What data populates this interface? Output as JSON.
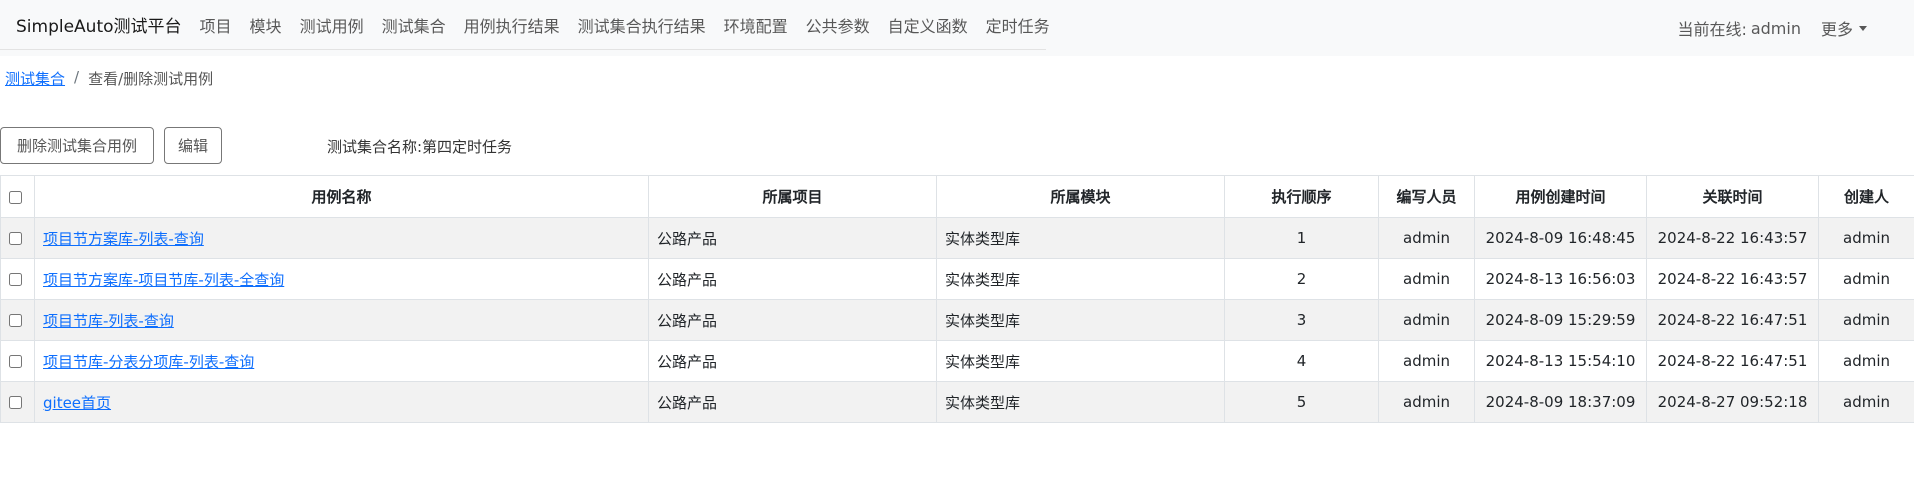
{
  "navbar": {
    "brand": "SimpleAuto测试平台",
    "links": [
      "项目",
      "模块",
      "测试用例",
      "测试集合",
      "用例执行结果",
      "测试集合执行结果",
      "环境配置",
      "公共参数",
      "自定义函数",
      "定时任务"
    ],
    "online_label": "当前在线:",
    "online_user": "admin",
    "more": "更多"
  },
  "breadcrumb": {
    "parent": "测试集合",
    "separator": "/",
    "current": "查看/删除测试用例"
  },
  "toolbar": {
    "delete_label": "删除测试集合用例",
    "edit_label": "编辑",
    "suite_name": "测试集合名称:第四定时任务"
  },
  "table": {
    "headers": [
      "用例名称",
      "所属项目",
      "所属模块",
      "执行顺序",
      "编写人员",
      "用例创建时间",
      "关联时间",
      "创建人"
    ],
    "rows": [
      {
        "name": "项目节方案库-列表-查询",
        "project": "公路产品",
        "module": "实体类型库",
        "order": "1",
        "writer": "admin",
        "created": "2024-8-09 16:48:45",
        "linked": "2024-8-22 16:43:57",
        "creator": "admin"
      },
      {
        "name": "项目节方案库-项目节库-列表-全查询",
        "project": "公路产品",
        "module": "实体类型库",
        "order": "2",
        "writer": "admin",
        "created": "2024-8-13 16:56:03",
        "linked": "2024-8-22 16:43:57",
        "creator": "admin"
      },
      {
        "name": "项目节库-列表-查询",
        "project": "公路产品",
        "module": "实体类型库",
        "order": "3",
        "writer": "admin",
        "created": "2024-8-09 15:29:59",
        "linked": "2024-8-22 16:47:51",
        "creator": "admin"
      },
      {
        "name": "项目节库-分表分项库-列表-查询",
        "project": "公路产品",
        "module": "实体类型库",
        "order": "4",
        "writer": "admin",
        "created": "2024-8-13 15:54:10",
        "linked": "2024-8-22 16:47:51",
        "creator": "admin"
      },
      {
        "name": "gitee首页",
        "project": "公路产品",
        "module": "实体类型库",
        "order": "5",
        "writer": "admin",
        "created": "2024-8-09 18:37:09",
        "linked": "2024-8-27 09:52:18",
        "creator": "admin"
      }
    ]
  },
  "colors": {
    "link": "#0d6efd",
    "navbar_bg": "#f8f9fa",
    "stripe": "#f2f2f2"
  }
}
